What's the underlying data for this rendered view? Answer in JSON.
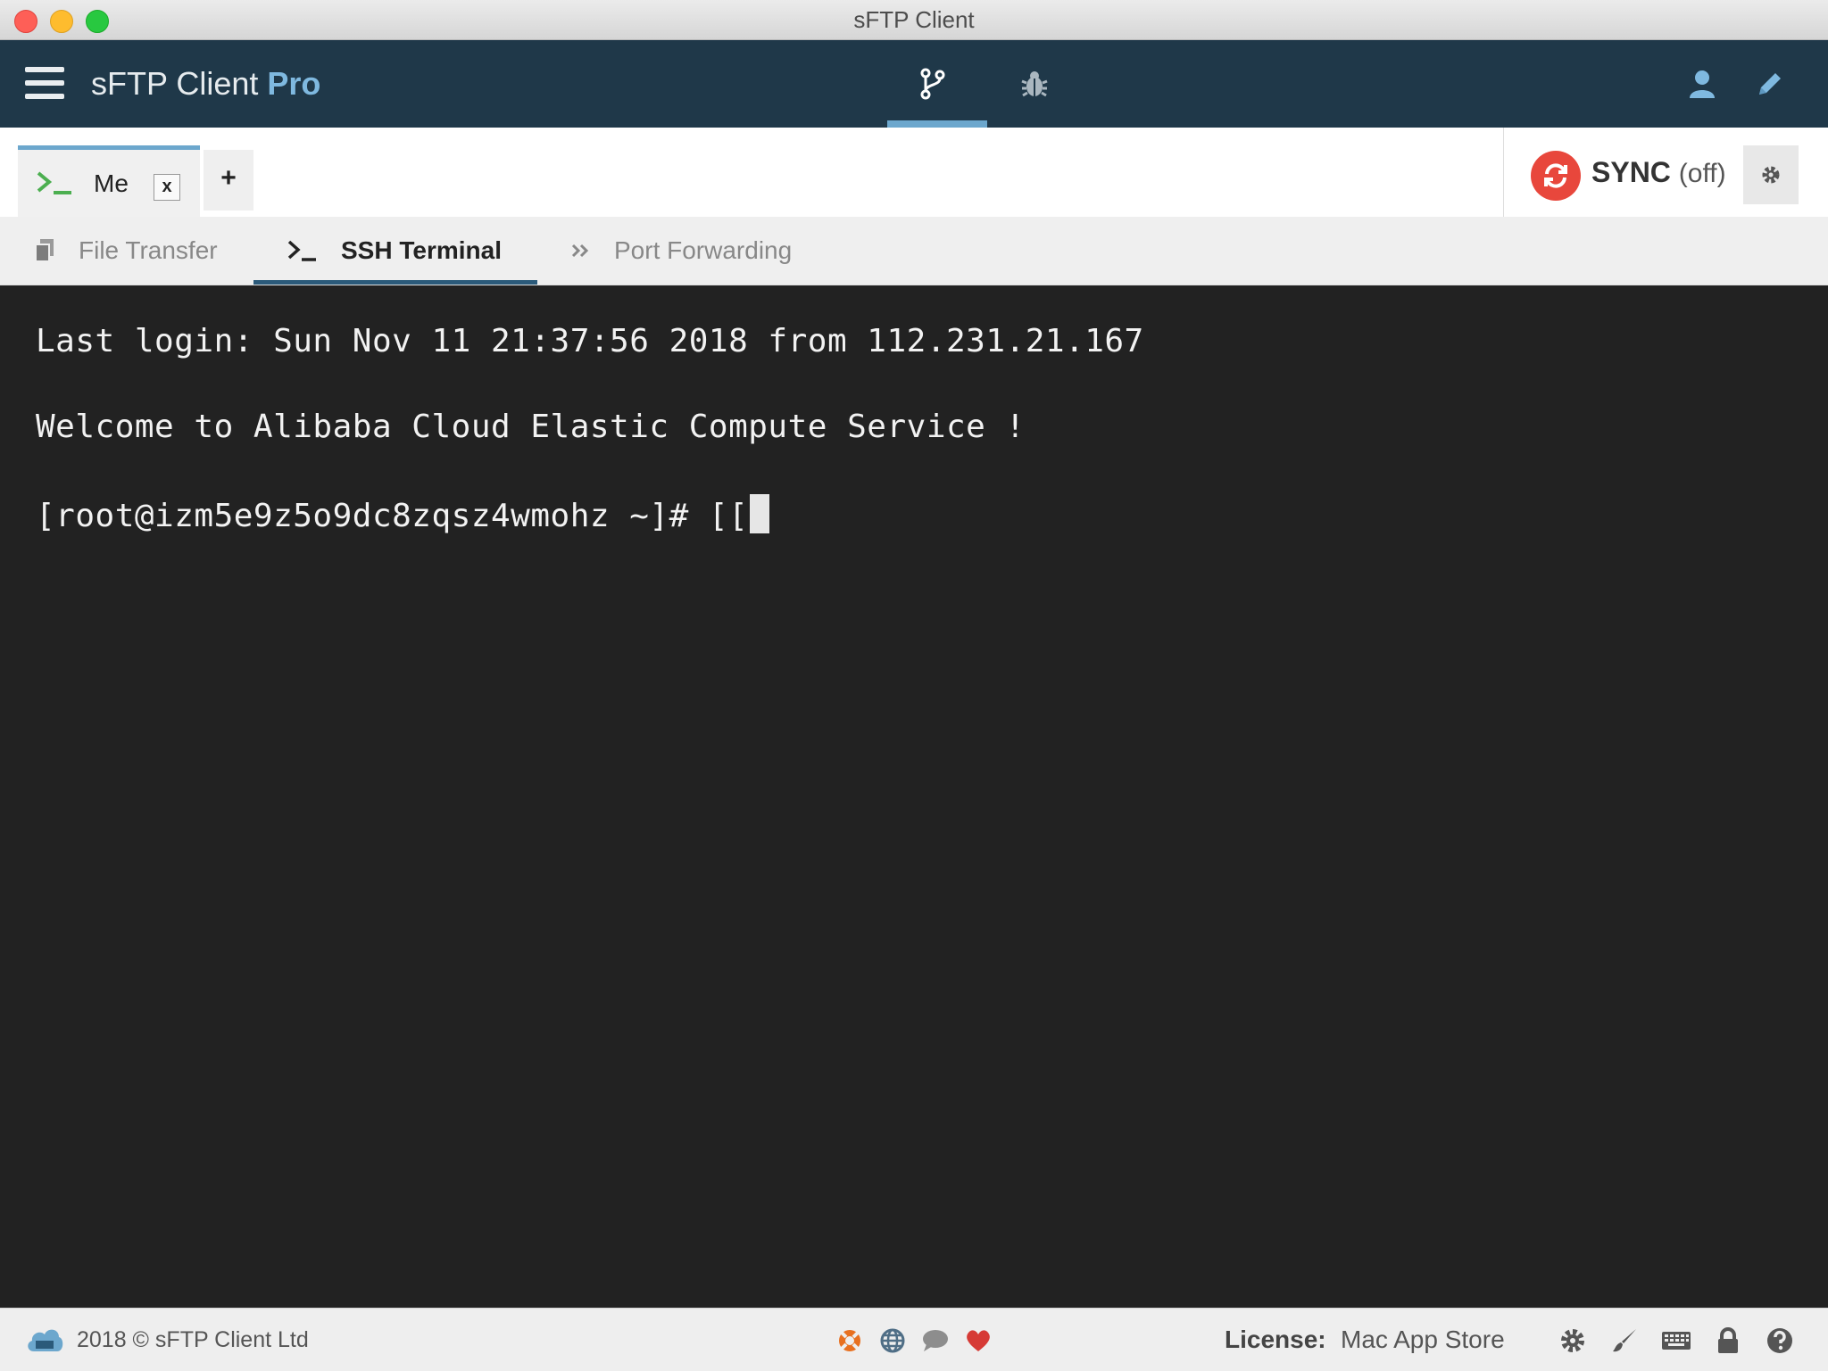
{
  "window": {
    "title": "sFTP Client"
  },
  "header": {
    "brand": "sFTP Client",
    "brand_suffix": "Pro",
    "nav": [
      {
        "icon": "branch-icon",
        "active": true
      },
      {
        "icon": "bug-icon",
        "active": false
      }
    ],
    "right_icons": [
      "user-icon",
      "pencil-icon"
    ]
  },
  "session": {
    "tab_name": "Me",
    "close_label": "x",
    "add_label": "+"
  },
  "sync": {
    "label": "SYNC",
    "state": "(off)"
  },
  "mode_tabs": [
    {
      "label": "File Transfer",
      "icon": "copy-icon",
      "active": false
    },
    {
      "label": "SSH Terminal",
      "icon": "terminal-icon",
      "active": true
    },
    {
      "label": "Port Forwarding",
      "icon": "double-chevron-icon",
      "active": false
    }
  ],
  "terminal": {
    "lines": [
      "Last login: Sun Nov 11 21:37:56 2018 from 112.231.21.167",
      "Welcome to Alibaba Cloud Elastic Compute Service !",
      "[root@izm5e9z5o9dc8zqsz4wmohz ~]# [["
    ]
  },
  "footer": {
    "copyright": "2018 © sFTP Client Ltd",
    "mid_icons": [
      "lifebuoy-icon",
      "globe-icon",
      "chat-icon",
      "heart-icon"
    ],
    "license_label": "License:",
    "license_value": "Mac App Store",
    "right_icons": [
      "gear-icon",
      "brush-icon",
      "keyboard-icon",
      "lock-icon",
      "help-icon"
    ]
  },
  "colors": {
    "header_bg": "#1f3849",
    "accent": "#6ca7cd",
    "terminal_bg": "#222222",
    "sync_red": "#e8473c",
    "prompt_green": "#4caf50"
  }
}
